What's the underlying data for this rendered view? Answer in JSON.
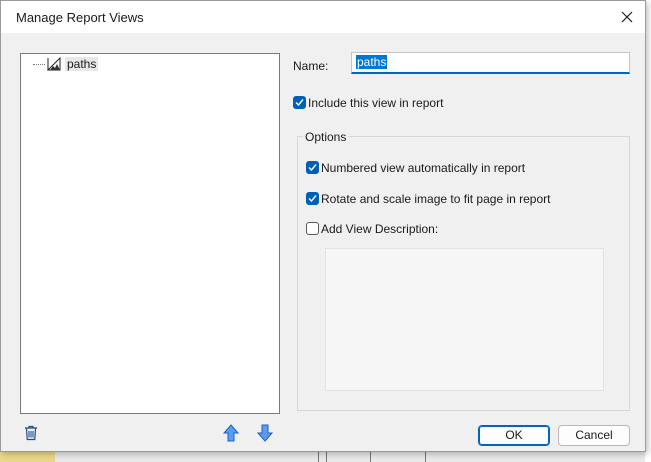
{
  "dialog": {
    "title": "Manage Report Views"
  },
  "tree": {
    "items": [
      {
        "label": "paths",
        "icon": "report-view-icon"
      }
    ]
  },
  "form": {
    "name_label": "Name:",
    "name_value": "paths",
    "include_label": "Include this view in report",
    "include_checked": true,
    "options_title": "Options",
    "numbered_label": "Numbered view automatically in report",
    "numbered_checked": true,
    "rotate_label": "Rotate and scale image to fit page in report",
    "rotate_checked": true,
    "add_desc_label": "Add View Description:",
    "add_desc_checked": false,
    "description_value": ""
  },
  "buttons": {
    "ok": "OK",
    "cancel": "Cancel"
  },
  "icons": {
    "close": "close-icon",
    "delete": "trash-icon",
    "up": "arrow-up-icon",
    "down": "arrow-down-icon"
  },
  "colors": {
    "accent": "#005fb8",
    "selection": "#0078d7",
    "arrow": "#3d7fe0"
  }
}
